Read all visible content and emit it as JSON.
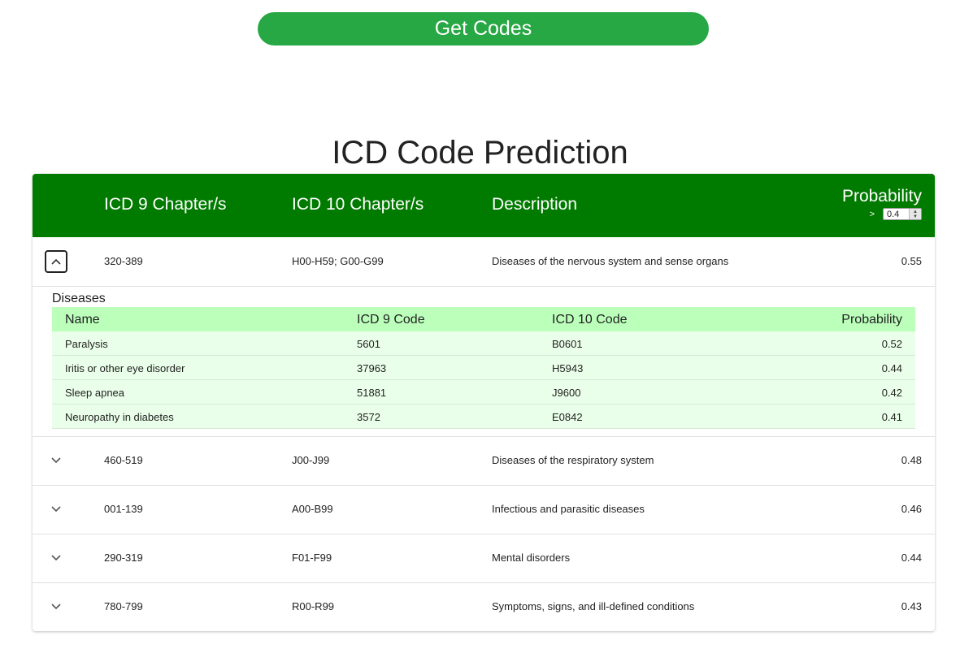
{
  "get_codes_label": "Get Codes",
  "title": "ICD Code Prediction",
  "table": {
    "headers": {
      "icd9": "ICD 9 Chapter/s",
      "icd10": "ICD 10 Chapter/s",
      "description": "Description",
      "probability": "Probability"
    },
    "threshold": {
      "operator": ">",
      "value": "0.4"
    },
    "rows": [
      {
        "expanded": true,
        "icd9": "320-389",
        "icd10": "H00-H59; G00-G99",
        "description": "Diseases of the nervous system and sense organs",
        "probability": "0.55",
        "detail": {
          "title": "Diseases",
          "headers": {
            "name": "Name",
            "icd9": "ICD 9 Code",
            "icd10": "ICD 10 Code",
            "probability": "Probability"
          },
          "rows": [
            {
              "name": "Paralysis",
              "icd9": "5601",
              "icd10": "B0601",
              "probability": "0.52"
            },
            {
              "name": "Iritis or other eye disorder",
              "icd9": "37963",
              "icd10": "H5943",
              "probability": "0.44"
            },
            {
              "name": "Sleep apnea",
              "icd9": "51881",
              "icd10": "J9600",
              "probability": "0.42"
            },
            {
              "name": "Neuropathy in diabetes",
              "icd9": "3572",
              "icd10": "E0842",
              "probability": "0.41"
            }
          ]
        }
      },
      {
        "expanded": false,
        "icd9": "460-519",
        "icd10": "J00-J99",
        "description": "Diseases of the respiratory system",
        "probability": "0.48"
      },
      {
        "expanded": false,
        "icd9": "001-139",
        "icd10": "A00-B99",
        "description": "Infectious and parasitic diseases",
        "probability": "0.46"
      },
      {
        "expanded": false,
        "icd9": "290-319",
        "icd10": "F01-F99",
        "description": "Mental disorders",
        "probability": "0.44"
      },
      {
        "expanded": false,
        "icd9": "780-799",
        "icd10": "R00-R99",
        "description": "Symptoms, signs, and ill-defined conditions",
        "probability": "0.43"
      }
    ]
  },
  "colors": {
    "button": "#28a745",
    "header": "#007b00",
    "sub_header": "#bbffbb",
    "sub_row": "#eaffea"
  },
  "icons": {
    "expanded": "chevron-up-icon",
    "collapsed": "chevron-down-icon"
  }
}
